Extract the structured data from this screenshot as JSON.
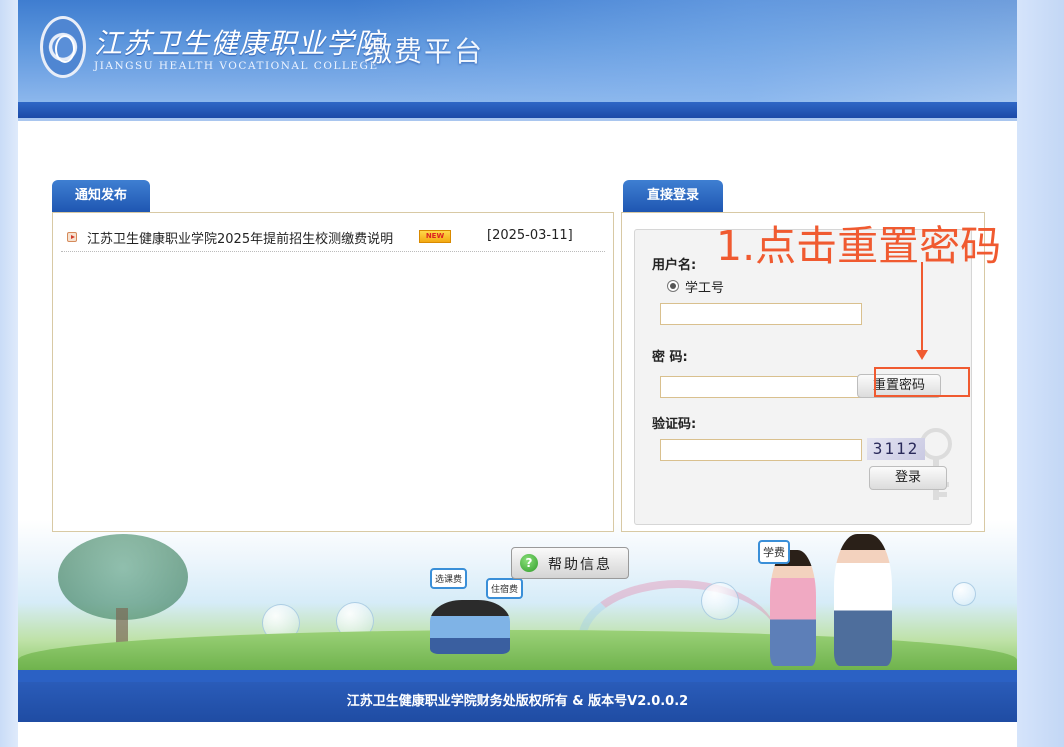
{
  "header": {
    "college_name_cn": "江苏卫生健康职业学院",
    "college_name_en": "JIANGSU HEALTH VOCATIONAL COLLEGE",
    "platform_title": "缴费平台"
  },
  "notice": {
    "tab_label": "通知发布",
    "items": [
      {
        "title": "江苏卫生健康职业学院2025年提前招生校测缴费说明",
        "badge": "NEW",
        "date": "[2025-03-11]"
      }
    ]
  },
  "login": {
    "tab_label": "直接登录",
    "username_label": "用户名:",
    "id_type_option": "学工号",
    "username_value": "",
    "password_label": "密 码:",
    "password_value": "",
    "reset_password_button": "重置密码",
    "captcha_label": "验证码:",
    "captcha_value": "",
    "captcha_image_text": "3112",
    "login_button": "登录"
  },
  "annotation": {
    "text": "1.点击重置密码",
    "color": "#f05a30"
  },
  "help": {
    "icon_glyph": "?",
    "label": "帮助信息"
  },
  "scene_tags": {
    "tag1": "选课费",
    "tag2": "住宿费",
    "tag3": "学费"
  },
  "footer": {
    "copyright": "江苏卫生健康职业学院财务处版权所有 & 版本号V2.0.0.2"
  },
  "colors": {
    "brand_blue": "#1f56b2",
    "footer_blue": "#1f4ca3",
    "annotation_red": "#f05a30"
  }
}
